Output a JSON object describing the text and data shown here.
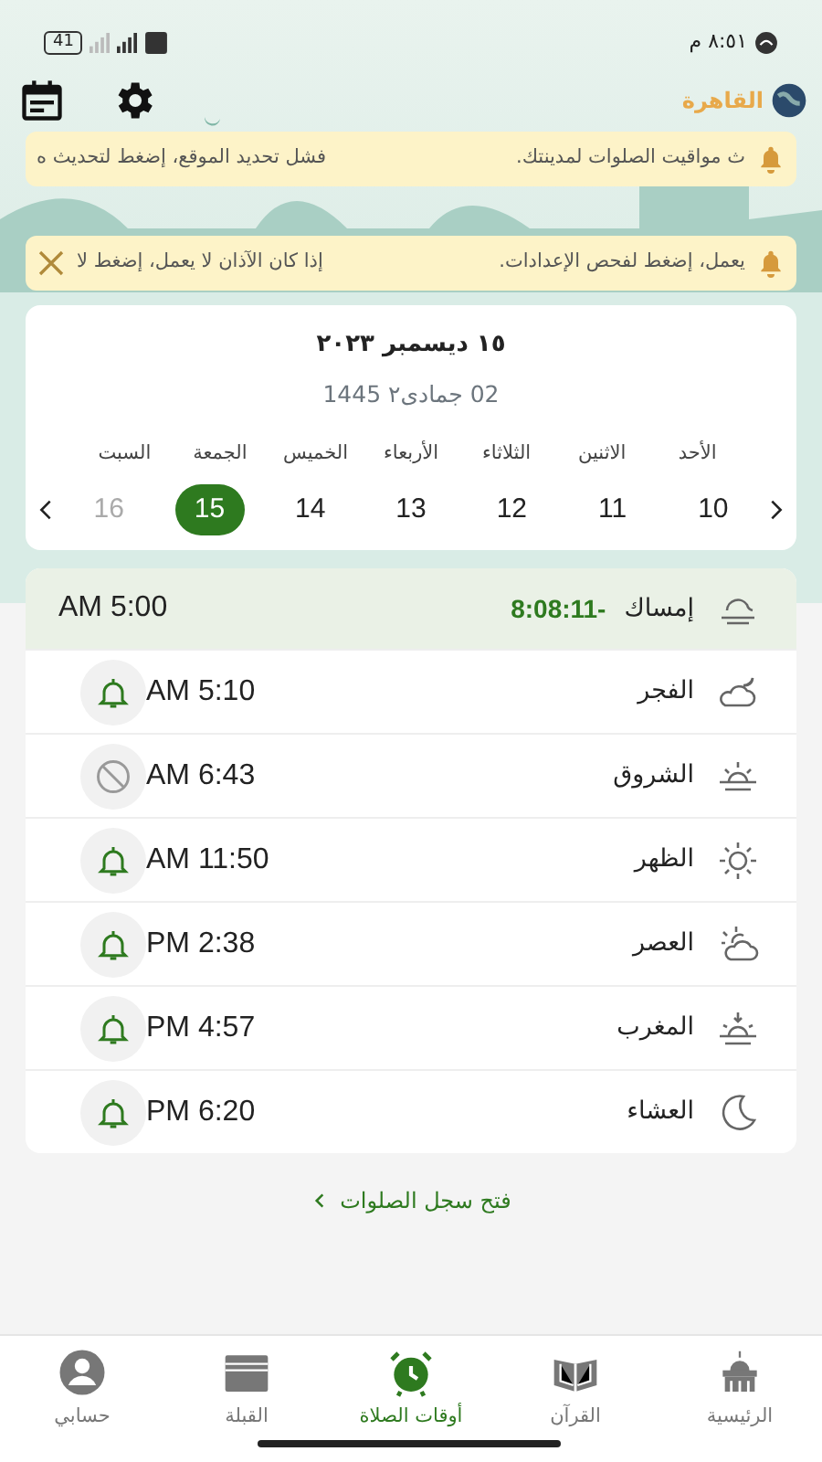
{
  "status_bar": {
    "time": "٨:٥١ م",
    "battery": "41"
  },
  "header": {
    "city": "القاهرة"
  },
  "notices": [
    {
      "lead": "ث مواقيت الصلوات لمدينتك.",
      "tail": "فشل تحديد الموقع، إضغط لتحديث ه",
      "closable": false
    },
    {
      "lead": "يعمل، إضغط لفحص الإعدادات.",
      "tail": "إذا كان الآذان لا يعمل، إضغط لا",
      "closable": true
    }
  ],
  "calendar": {
    "gregorian": "١٥ ديسمبر ٢٠٢٣",
    "hijri": "02 جمادى٢ 1445",
    "days": [
      {
        "weekday": "الأحد",
        "day": "10",
        "selected": false,
        "dimmed": false
      },
      {
        "weekday": "الاثنين",
        "day": "11",
        "selected": false,
        "dimmed": false
      },
      {
        "weekday": "الثلاثاء",
        "day": "12",
        "selected": false,
        "dimmed": false
      },
      {
        "weekday": "الأربعاء",
        "day": "13",
        "selected": false,
        "dimmed": false
      },
      {
        "weekday": "الخميس",
        "day": "14",
        "selected": false,
        "dimmed": false
      },
      {
        "weekday": "الجمعة",
        "day": "15",
        "selected": true,
        "dimmed": false
      },
      {
        "weekday": "السبت",
        "day": "16",
        "selected": false,
        "dimmed": true
      }
    ]
  },
  "prayers": [
    {
      "kind": "imsak",
      "name": "إمساك",
      "countdown": "8:08:11-",
      "time": "AM 5:00",
      "current": true
    },
    {
      "kind": "fajr",
      "name": "الفجر",
      "time": "AM 5:10",
      "current": false,
      "alarm_enabled": true
    },
    {
      "kind": "sunrise",
      "name": "الشروق",
      "time": "AM 6:43",
      "current": false,
      "alarm_enabled": false
    },
    {
      "kind": "dhuhr",
      "name": "الظهر",
      "time": "AM 11:50",
      "current": false,
      "alarm_enabled": true
    },
    {
      "kind": "asr",
      "name": "العصر",
      "time": "PM 2:38",
      "current": false,
      "alarm_enabled": true
    },
    {
      "kind": "maghrib",
      "name": "المغرب",
      "time": "PM 4:57",
      "current": false,
      "alarm_enabled": true
    },
    {
      "kind": "isha",
      "name": "العشاء",
      "time": "PM 6:20",
      "current": false,
      "alarm_enabled": true
    }
  ],
  "history_link": "فتح سجل الصلوات",
  "bottom_nav": [
    {
      "kind": "home",
      "label": "الرئيسية",
      "selected": false
    },
    {
      "kind": "quran",
      "label": "القرآن",
      "selected": false
    },
    {
      "kind": "times",
      "label": "أوقات الصلاة",
      "selected": true
    },
    {
      "kind": "qibla",
      "label": "القبلة",
      "selected": false
    },
    {
      "kind": "account",
      "label": "حسابي",
      "selected": false
    }
  ]
}
